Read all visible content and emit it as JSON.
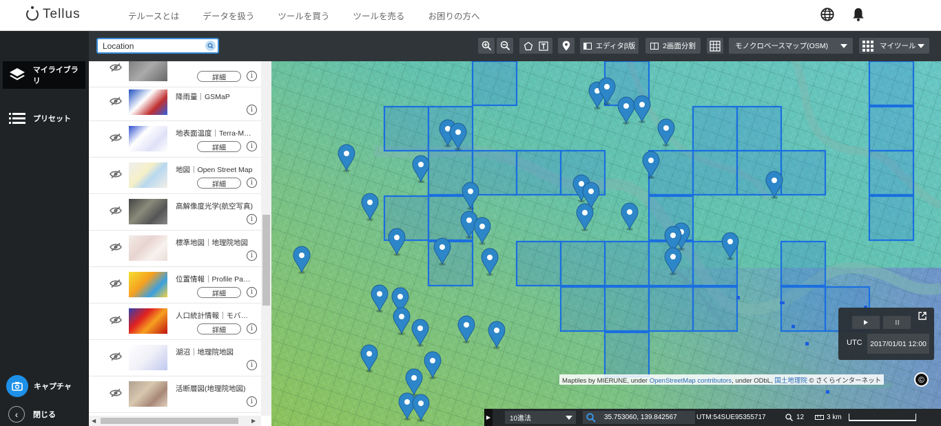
{
  "app": {
    "brand": "Tellus"
  },
  "nav": [
    "テルースとは",
    "データを扱う",
    "ツールを買う",
    "ツールを売る",
    "お困りの方へ"
  ],
  "rail": {
    "library": "マイライブラリ",
    "preset": "プリセット",
    "capture": "キャプチャ",
    "close": "閉じる"
  },
  "search": {
    "value": "Location"
  },
  "toolbar": {
    "editor_label": "エディタβ版",
    "split_label": "2画面分割",
    "basemap": "モノクロベースマップ(OSM)",
    "mytools": "マイツール"
  },
  "layers": [
    {
      "title": "",
      "detail": "詳細",
      "has_detail": true
    },
    {
      "title": "降雨量｜GSMaP",
      "detail": "",
      "has_detail": false
    },
    {
      "title": "地表面温度｜Terra-MODIS",
      "detail": "詳細",
      "has_detail": true
    },
    {
      "title": "地図｜Open Street Map",
      "detail": "詳細",
      "has_detail": true
    },
    {
      "title": "高解像度光学(航空写真)",
      "detail": "",
      "has_detail": false
    },
    {
      "title": "標準地図｜地理院地図",
      "detail": "",
      "has_detail": false
    },
    {
      "title": "位置情報｜Profile Passport",
      "detail": "詳細",
      "has_detail": true
    },
    {
      "title": "人口統計情報｜モバイル空間統計",
      "detail": "詳細",
      "has_detail": true
    },
    {
      "title": "湖沼｜地理院地図",
      "detail": "",
      "has_detail": false
    },
    {
      "title": "活断層図(地理院地図)",
      "detail": "",
      "has_detail": false
    }
  ],
  "info_glyph": "i",
  "time": {
    "tz": "UTC",
    "datetime": "2017/01/01 12:00"
  },
  "attribution": {
    "prefix": "Maptiles by MIERUNE, under ",
    "osm": "OpenStreetMap contributors",
    "mid": ", under ODbL, ",
    "gsi": "国土地理院",
    "suffix": " © さくらインターネット"
  },
  "status": {
    "notation": "10進法",
    "coords": "35.753060, 139.842567",
    "utm": "UTM:54SUE95355717",
    "zoom": "12",
    "scale": "3 km"
  },
  "colors": {
    "accent": "#1e90e8",
    "pin": "#2d86c8",
    "grid": "#1a6fe0"
  }
}
